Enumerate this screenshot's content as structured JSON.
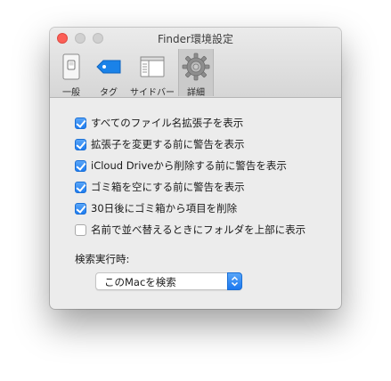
{
  "window": {
    "title": "Finder環境設定"
  },
  "toolbar": {
    "tabs": [
      {
        "label": "一般",
        "icon": "general-switch-icon",
        "selected": false
      },
      {
        "label": "タグ",
        "icon": "tag-icon",
        "selected": false
      },
      {
        "label": "サイドバー",
        "icon": "sidebar-icon",
        "selected": false
      },
      {
        "label": "詳細",
        "icon": "gear-icon",
        "selected": true
      }
    ]
  },
  "options": [
    {
      "label": "すべてのファイル名拡張子を表示",
      "checked": true
    },
    {
      "label": "拡張子を変更する前に警告を表示",
      "checked": true
    },
    {
      "label": "iCloud Driveから削除する前に警告を表示",
      "checked": true
    },
    {
      "label": "ゴミ箱を空にする前に警告を表示",
      "checked": true
    },
    {
      "label": "30日後にゴミ箱から項目を削除",
      "checked": true
    },
    {
      "label": "名前で並べ替えるときにフォルダを上部に表示",
      "checked": false
    }
  ],
  "search": {
    "label": "検索実行時:",
    "selected": "このMacを検索"
  },
  "colors": {
    "accent": "#1e7cf0",
    "close": "#fc5f57",
    "tag": "#1a82e8"
  }
}
